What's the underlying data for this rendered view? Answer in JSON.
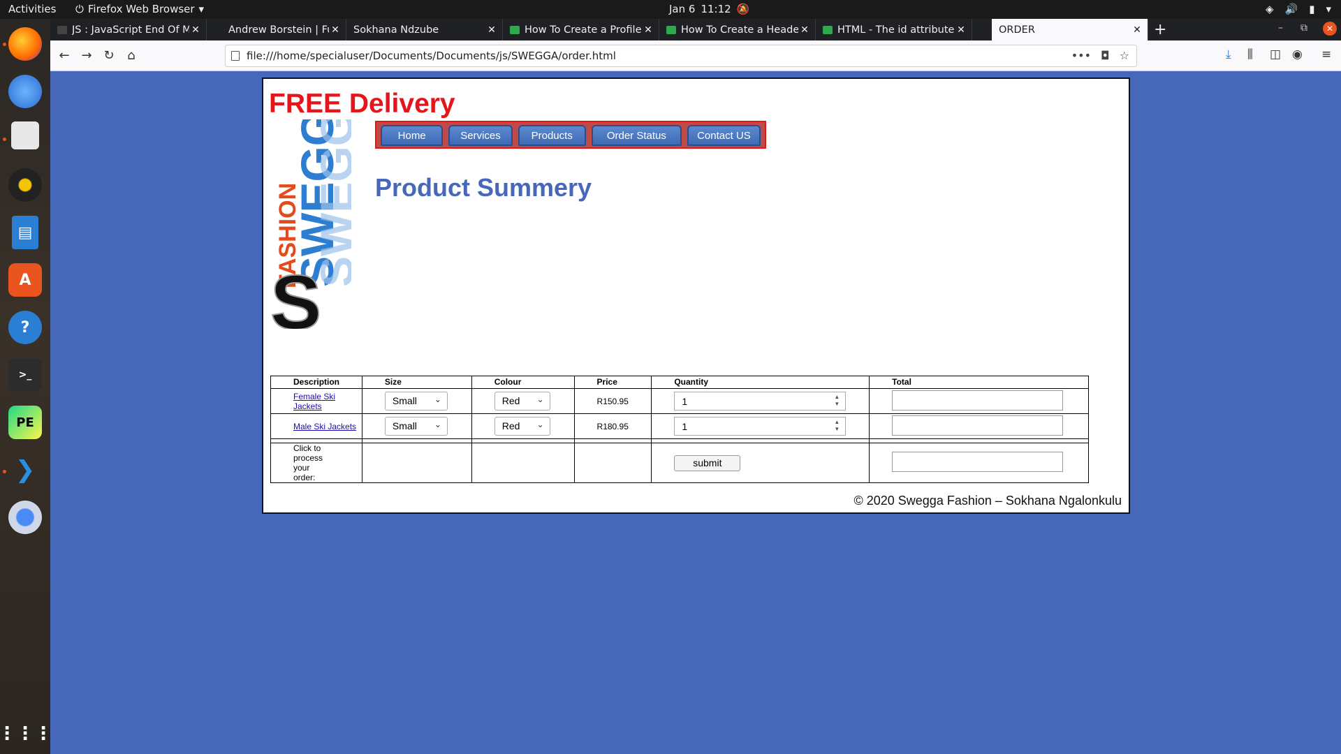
{
  "topbar": {
    "activities": "Activities",
    "app_name": "Firefox Web Browser",
    "date": "Jan 6",
    "time": "11:12"
  },
  "tabs": [
    {
      "label": "JS : JavaScript End Of Mc",
      "favicon_color": "#444444"
    },
    {
      "label": "Andrew Borstein | Full-St",
      "favicon_color": "#202124"
    },
    {
      "label": "Sokhana Ndzube",
      "favicon_color": "#202124"
    },
    {
      "label": "How To Create a Profile",
      "favicon_color": "#2cab4c"
    },
    {
      "label": "How To Create a Header",
      "favicon_color": "#2cab4c"
    },
    {
      "label": "HTML - The id attribute",
      "favicon_color": "#2cab4c"
    },
    {
      "label": "ORDER",
      "favicon_color": "#f9f9fb"
    }
  ],
  "url": "file:///home/specialuser/Documents/Documents/js/SWEGGA/order.html",
  "page": {
    "banner": "FREE Delivery",
    "logo_text": {
      "fashion": "FASHION",
      "swegga": "SWEGGA",
      "s": "S"
    },
    "menu": [
      "Home",
      "Services",
      "Products",
      "Order Status",
      "Contact US"
    ],
    "title": "Product Summery",
    "table": {
      "headers": [
        "Description",
        "Size",
        "Colour",
        "Price",
        "Quantity",
        "Total"
      ],
      "rows": [
        {
          "description": "Female Ski Jackets",
          "size": "Small",
          "colour": "Red",
          "price": "R150.95",
          "quantity": "1",
          "total": ""
        },
        {
          "description": "Male Ski Jackets",
          "size": "Small",
          "colour": "Red",
          "price": "R180.95",
          "quantity": "1",
          "total": ""
        }
      ],
      "process_label": "Click to process your order:",
      "submit_label": "submit",
      "grand_total": ""
    },
    "footer": "© 2020 Swegga Fashion – Sokhana Ngalonkulu"
  },
  "colors": {
    "page_background": "#4767b8",
    "banner_red": "#e3161c",
    "title_blue": "#4767b8",
    "menu_bar": "#bf4a4a"
  }
}
